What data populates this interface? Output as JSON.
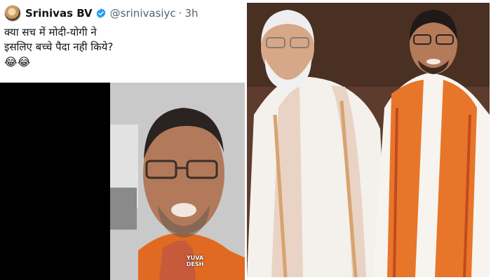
{
  "tweet": {
    "display_name": "Srinivas BV",
    "handle": "@srinivasiyc",
    "separator": "·",
    "time": "3h",
    "text_line1": "क्या सच में मोदी-योगी ने",
    "text_line2": "इसलिए बच्चे पैदा नही किये?",
    "emojis": "😂😂"
  },
  "video": {
    "watermark_line1": "YUVA",
    "watermark_line2": "DESH"
  },
  "colors": {
    "verified": "#1d9bf0",
    "name": "#0f1419",
    "meta": "#536471",
    "saffron": "#e8762a"
  }
}
